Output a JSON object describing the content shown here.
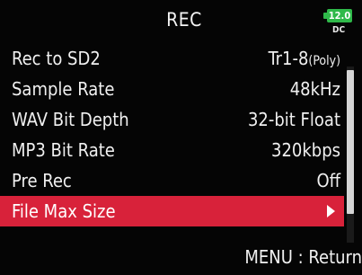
{
  "header": {
    "title": "REC",
    "battery_value": "12.0",
    "battery_source": "DC",
    "battery_icon": "battery-icon",
    "battery_color": "#2fb94a"
  },
  "menu": {
    "items": [
      {
        "label": "Rec to SD2",
        "value": "Tr1-8",
        "value_suffix": "(Poly)"
      },
      {
        "label": "Sample Rate",
        "value": "48kHz",
        "value_suffix": ""
      },
      {
        "label": "WAV Bit Depth",
        "value": "32-bit Float",
        "value_suffix": ""
      },
      {
        "label": "MP3 Bit Rate",
        "value": "320kbps",
        "value_suffix": ""
      },
      {
        "label": "Pre Rec",
        "value": "Off",
        "value_suffix": ""
      },
      {
        "label": "File Max Size",
        "value": "",
        "value_suffix": "",
        "selected": true,
        "icon": "arrow-right-icon"
      }
    ],
    "highlight_color": "#d8223a"
  },
  "footer": {
    "hint": "MENU : Return"
  }
}
